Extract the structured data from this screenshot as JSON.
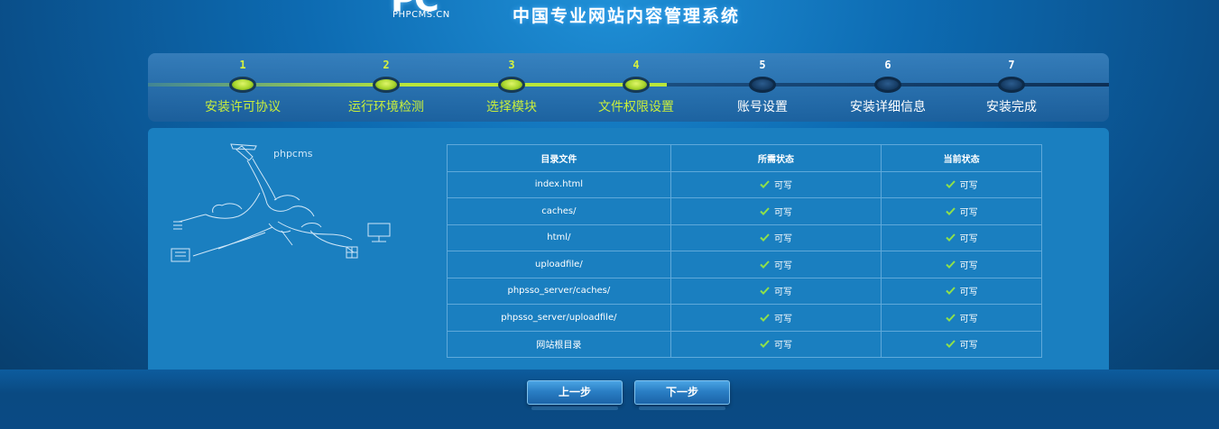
{
  "header": {
    "logo_letters": "PC",
    "logo_site": "PHPCMS.CN",
    "system_title": "中国专业网站内容管理系统"
  },
  "steps": [
    {
      "num": "1",
      "label": "安装许可协议",
      "status": "done"
    },
    {
      "num": "2",
      "label": "运行环境检测",
      "status": "done"
    },
    {
      "num": "3",
      "label": "选择模块",
      "status": "done"
    },
    {
      "num": "4",
      "label": "文件权限设置",
      "status": "current"
    },
    {
      "num": "5",
      "label": "账号设置",
      "status": "todo"
    },
    {
      "num": "6",
      "label": "安装详细信息",
      "status": "todo"
    },
    {
      "num": "7",
      "label": "安装完成",
      "status": "todo"
    }
  ],
  "illustration": {
    "brand": "phpcms"
  },
  "permissions_table": {
    "headers": [
      "目录文件",
      "所需状态",
      "当前状态"
    ],
    "rows": [
      {
        "path": "index.html",
        "required": "可写",
        "current": "可写"
      },
      {
        "path": "caches/",
        "required": "可写",
        "current": "可写"
      },
      {
        "path": "html/",
        "required": "可写",
        "current": "可写"
      },
      {
        "path": "uploadfile/",
        "required": "可写",
        "current": "可写"
      },
      {
        "path": "phpsso_server/caches/",
        "required": "可写",
        "current": "可写"
      },
      {
        "path": "phpsso_server/uploadfile/",
        "required": "可写",
        "current": "可写"
      },
      {
        "path": "网站根目录",
        "required": "可写",
        "current": "可写"
      }
    ]
  },
  "buttons": {
    "prev": "上一步",
    "next": "下一步"
  },
  "colors": {
    "done_accent": "#b9e63a",
    "check_green": "#8fe04a",
    "panel_blue": "#1a7fc0"
  }
}
